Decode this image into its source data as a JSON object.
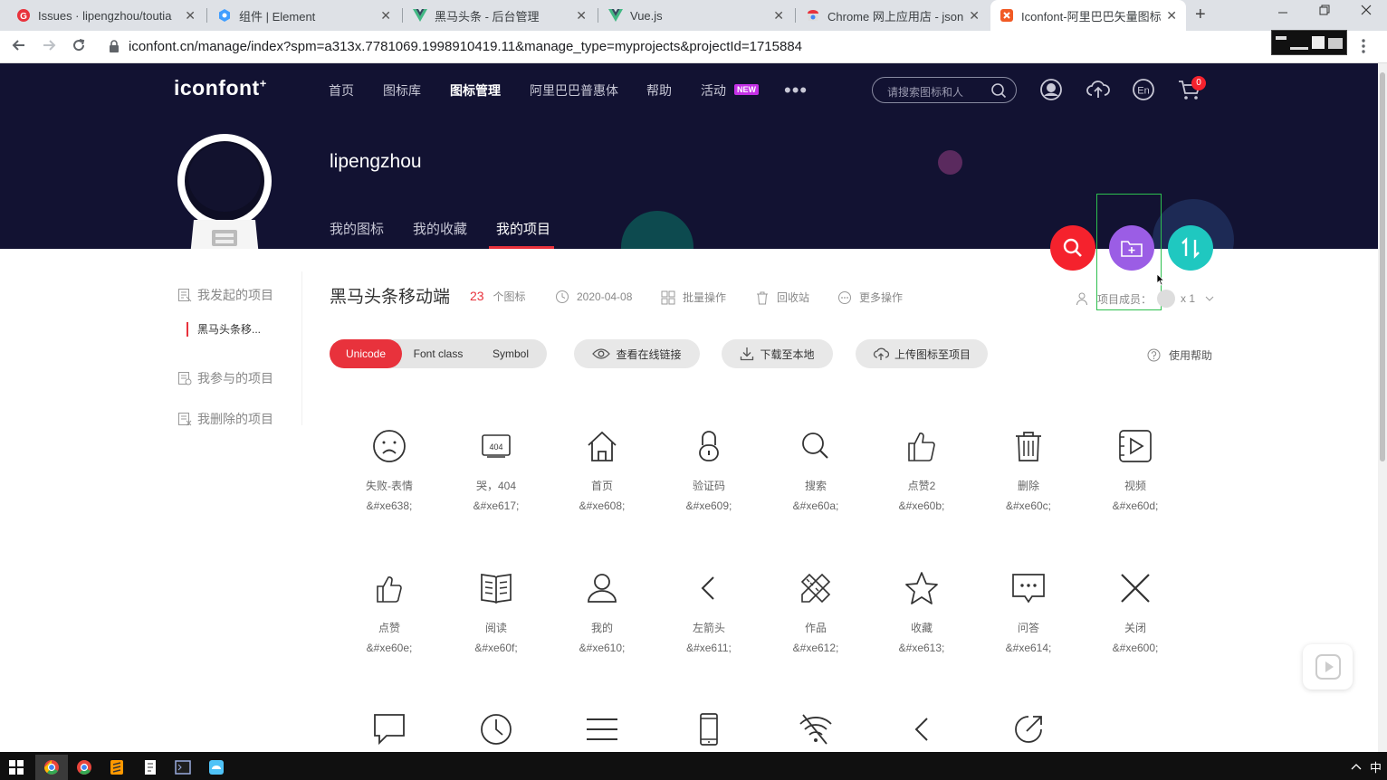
{
  "browser": {
    "tabs": [
      {
        "title": "Issues · lipengzhou/toutia",
        "favicon": "github-red-icon"
      },
      {
        "title": "组件 | Element",
        "favicon": "element-icon"
      },
      {
        "title": "黑马头条 - 后台管理",
        "favicon": "vue-icon"
      },
      {
        "title": "Vue.js",
        "favicon": "vue-icon"
      },
      {
        "title": "Chrome 网上应用店 - json",
        "favicon": "chrome-store-icon"
      },
      {
        "title": "Iconfont-阿里巴巴矢量图标",
        "favicon": "iconfont-icon"
      }
    ],
    "close_glyph": "✕",
    "new_tab_glyph": "+",
    "url": "iconfont.cn/manage/index?spm=a313x.7781069.1998910419.11&manage_type=myprojects&projectId=1715884"
  },
  "header": {
    "logo": "iconfont",
    "logo_mark": "+",
    "nav": [
      "首页",
      "图标库",
      "图标管理",
      "阿里巴巴普惠体",
      "帮助",
      "活动"
    ],
    "active_nav": "图标管理",
    "new_badge": "NEW",
    "more": "•••",
    "search_placeholder": "请搜索图标和人",
    "cart_count": "0"
  },
  "profile": {
    "username": "lipengzhou",
    "tabs": [
      "我的图标",
      "我的收藏",
      "我的项目"
    ],
    "active_tab": "我的项目"
  },
  "sidebar": {
    "items": [
      "我发起的项目",
      "我参与的项目",
      "我删除的项目"
    ],
    "sub_item": "黑马头条移..."
  },
  "project": {
    "title": "黑马头条移动端",
    "count": "23",
    "count_unit": "个图标",
    "date": "2020-04-08",
    "batch": "批量操作",
    "recycle": "回收站",
    "more_ops": "更多操作",
    "members_label": "项目成员：",
    "members_count": "x 1"
  },
  "toolbar": {
    "segments": [
      "Unicode",
      "Font class",
      "Symbol"
    ],
    "active_segment": "Unicode",
    "view_link": "查看在线链接",
    "download": "下载至本地",
    "upload": "上传图标至项目",
    "help": "使用帮助"
  },
  "icons": [
    {
      "name": "失败-表情",
      "code": "&#xe638;",
      "icon": "sad-face-icon"
    },
    {
      "name": "哭，404",
      "code": "&#xe617;",
      "icon": "crying-404-icon"
    },
    {
      "name": "首页",
      "code": "&#xe608;",
      "icon": "home-icon"
    },
    {
      "name": "验证码",
      "code": "&#xe609;",
      "icon": "lock-icon"
    },
    {
      "name": "搜索",
      "code": "&#xe60a;",
      "icon": "search-icon"
    },
    {
      "name": "点赞2",
      "code": "&#xe60b;",
      "icon": "thumbs-up-icon"
    },
    {
      "name": "删除",
      "code": "&#xe60c;",
      "icon": "trash-icon"
    },
    {
      "name": "视频",
      "code": "&#xe60d;",
      "icon": "video-icon"
    },
    {
      "name": "点赞",
      "code": "&#xe60e;",
      "icon": "like-icon"
    },
    {
      "name": "阅读",
      "code": "&#xe60f;",
      "icon": "book-icon"
    },
    {
      "name": "我的",
      "code": "&#xe610;",
      "icon": "user-icon"
    },
    {
      "name": "左箭头",
      "code": "&#xe611;",
      "icon": "arrow-left-icon"
    },
    {
      "name": "作品",
      "code": "&#xe612;",
      "icon": "pencil-ruler-icon"
    },
    {
      "name": "收藏",
      "code": "&#xe613;",
      "icon": "star-icon"
    },
    {
      "name": "问答",
      "code": "&#xe614;",
      "icon": "chat-icon"
    },
    {
      "name": "关闭",
      "code": "&#xe600;",
      "icon": "close-icon"
    }
  ],
  "partial_icons": [
    "comment-icon",
    "clock-icon",
    "menu-icon",
    "phone-icon",
    "no-wifi-icon",
    "back-icon",
    "share-icon"
  ],
  "taskbar": {
    "ime": "中",
    "apps": [
      "chrome-icon",
      "chrome-icon",
      "sublime-icon",
      "notepad-icon",
      "terminal-icon",
      "app-icon"
    ]
  },
  "colors": {
    "accent": "#e8323c",
    "hero_bg": "#121232",
    "fab_search": "#f5222d",
    "fab_folder": "#9b5de5",
    "fab_sort": "#1fc8c0"
  }
}
